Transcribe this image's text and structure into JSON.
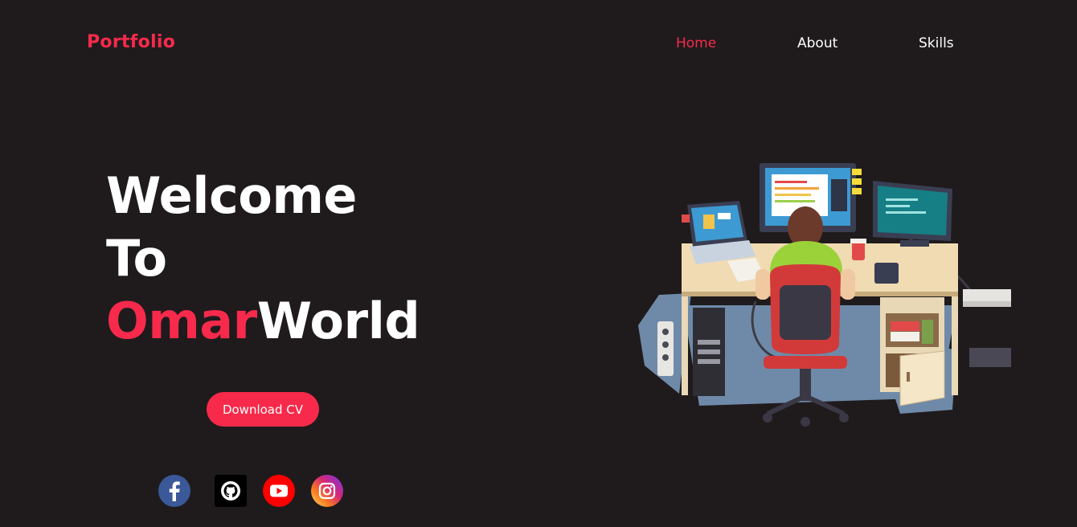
{
  "header": {
    "logo": "Portfolio",
    "nav": [
      {
        "label": "Home",
        "active": true
      },
      {
        "label": "About",
        "active": false
      },
      {
        "label": "Skills",
        "active": false
      }
    ]
  },
  "hero": {
    "line1": "Welcome",
    "line2": "To",
    "accent": "Omar",
    "rest": "World",
    "button_label": "Download CV"
  },
  "social": [
    "facebook-icon",
    "github-icon",
    "youtube-icon",
    "instagram-icon"
  ],
  "colors": {
    "background": "#1f1b1d",
    "accent": "#f72a4b",
    "text": "#ffffff"
  }
}
